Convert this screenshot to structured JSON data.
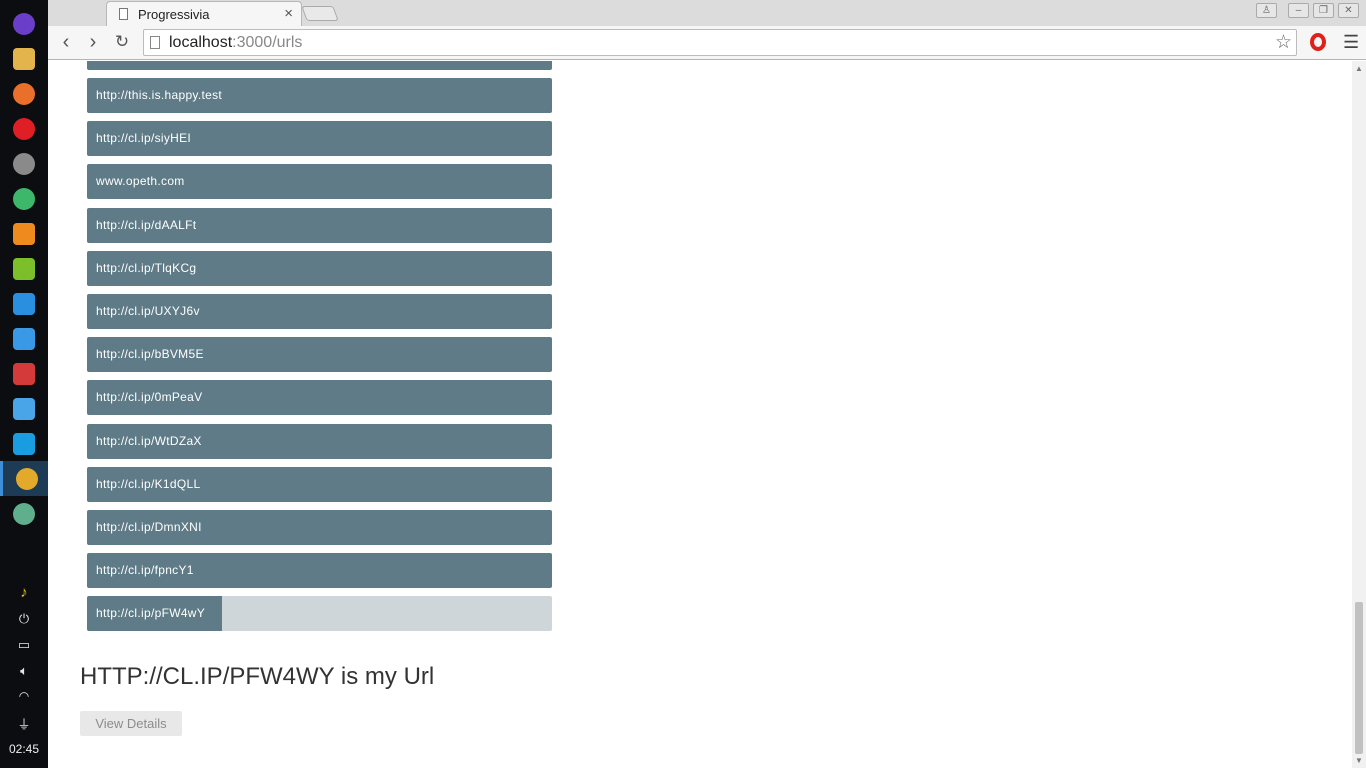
{
  "dock": {
    "apps": [
      {
        "name": "launcher",
        "color": "#6b3ec9"
      },
      {
        "name": "files",
        "color": "#e3b34c"
      },
      {
        "name": "firefox",
        "color": "#e8702a"
      },
      {
        "name": "opera",
        "color": "#e01e25"
      },
      {
        "name": "settings",
        "color": "#8a8a8a"
      },
      {
        "name": "chat",
        "color": "#3db86a"
      },
      {
        "name": "store",
        "color": "#ef8b1e"
      },
      {
        "name": "music",
        "color": "#7cbf2b"
      },
      {
        "name": "video",
        "color": "#2b8fe0"
      },
      {
        "name": "disk",
        "color": "#3a99e6"
      },
      {
        "name": "terminal",
        "color": "#d43a3a"
      },
      {
        "name": "archive",
        "color": "#4aa5e8"
      },
      {
        "name": "writer",
        "color": "#1a9ce0"
      },
      {
        "name": "chrome",
        "color": "#e2a92b"
      },
      {
        "name": "atom",
        "color": "#5fae8c"
      }
    ],
    "clock": "02:45"
  },
  "browser": {
    "tab_title": "Progressivia",
    "url_host": "localhost",
    "url_path": ":3000/urls"
  },
  "urls": {
    "items": [
      "http://this.is.happy.test",
      "http://cl.ip/siyHEI",
      "www.opeth.com",
      "http://cl.ip/dAALFt",
      "http://cl.ip/TlqKCg",
      "http://cl.ip/UXYJ6v",
      "http://cl.ip/bBVM5E",
      "http://cl.ip/0mPeaV",
      "http://cl.ip/WtDZaX",
      "http://cl.ip/K1dQLL",
      "http://cl.ip/DmnXNI",
      "http://cl.ip/fpncY1"
    ],
    "selected": {
      "label": "http://cl.ip/pFW4wY",
      "progress": 0.29
    }
  },
  "detail": {
    "headline": "HTTP://CL.IP/PFW4WY is my Url",
    "button_label": "View Details"
  },
  "colors": {
    "item_bg": "#5f7b87",
    "item_track": "#cfd6da"
  }
}
